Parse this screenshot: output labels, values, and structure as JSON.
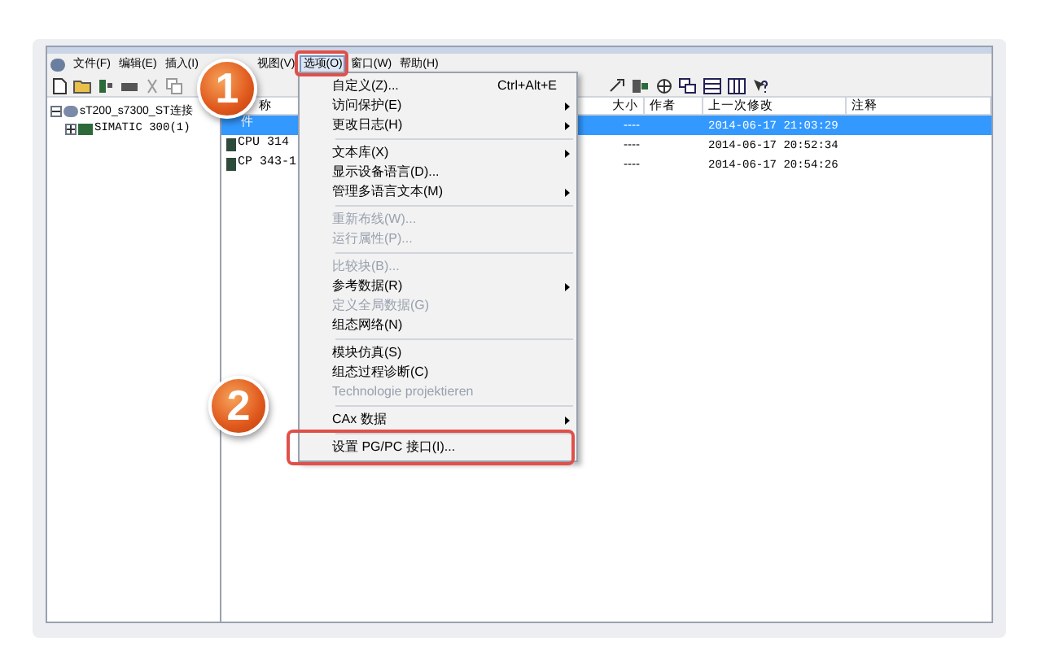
{
  "menu_bar": [
    {
      "label": "文件(F)",
      "selected": false
    },
    {
      "label": "编辑(E)",
      "selected": false
    },
    {
      "label": "插入(I)",
      "selected": false
    },
    {
      "label": "视图(V)",
      "selected": false
    },
    {
      "label": "选项(O)",
      "selected": true
    },
    {
      "label": "窗口(W)",
      "selected": false
    },
    {
      "label": "帮助(H)",
      "selected": false
    }
  ],
  "tree": [
    {
      "label": "sT200_s7300_ST连接",
      "expanded": true,
      "children": [
        {
          "label": "SIMATIC 300(1)",
          "expanded": false
        }
      ]
    }
  ],
  "list": {
    "columns": [
      "称",
      "大小",
      "作者",
      "上一次修改",
      "注释"
    ],
    "rows": [
      {
        "name": "件",
        "size": "----",
        "modified": "2014-06-17 21:03:29",
        "selected": true
      },
      {
        "name": "CPU 314",
        "size": "----",
        "modified": "2014-06-17 20:52:34",
        "selected": false
      },
      {
        "name": "CP 343-1",
        "size": "----",
        "modified": "2014-06-17 20:54:26",
        "selected": false
      }
    ]
  },
  "options_menu": {
    "items": [
      {
        "kind": "item",
        "label": "自定义(Z)...",
        "shortcut": "Ctrl+Alt+E",
        "submenu": false,
        "disabled": false
      },
      {
        "kind": "item",
        "label": "访问保护(E)",
        "submenu": true,
        "disabled": false
      },
      {
        "kind": "item",
        "label": "更改日志(H)",
        "submenu": true,
        "disabled": false
      },
      {
        "kind": "separator"
      },
      {
        "kind": "item",
        "label": "文本库(X)",
        "submenu": true,
        "disabled": false
      },
      {
        "kind": "item",
        "label": "显示设备语言(D)...",
        "submenu": false,
        "disabled": false
      },
      {
        "kind": "item",
        "label": "管理多语言文本(M)",
        "submenu": true,
        "disabled": false
      },
      {
        "kind": "separator"
      },
      {
        "kind": "item",
        "label": "重新布线(W)...",
        "submenu": false,
        "disabled": true
      },
      {
        "kind": "item",
        "label": "运行属性(P)...",
        "submenu": false,
        "disabled": true
      },
      {
        "kind": "separator"
      },
      {
        "kind": "item",
        "label": "比较块(B)...",
        "submenu": false,
        "disabled": true
      },
      {
        "kind": "item",
        "label": "参考数据(R)",
        "submenu": true,
        "disabled": false
      },
      {
        "kind": "item",
        "label": "定义全局数据(G)",
        "submenu": false,
        "disabled": true
      },
      {
        "kind": "item",
        "label": "组态网络(N)",
        "submenu": false,
        "disabled": false
      },
      {
        "kind": "separator"
      },
      {
        "kind": "item",
        "label": "模块仿真(S)",
        "submenu": false,
        "disabled": false
      },
      {
        "kind": "item",
        "label": "组态过程诊断(C)",
        "submenu": false,
        "disabled": false
      },
      {
        "kind": "item",
        "label": "Technologie projektieren",
        "submenu": false,
        "disabled": true
      },
      {
        "kind": "separator"
      },
      {
        "kind": "item",
        "label": "CAx 数据",
        "submenu": true,
        "disabled": false
      },
      {
        "kind": "separator"
      },
      {
        "kind": "item",
        "label": "设置 PG/PC 接口(I)...",
        "submenu": false,
        "disabled": false,
        "highlighted": true
      }
    ]
  },
  "callouts": [
    {
      "label": "1"
    },
    {
      "label": "2"
    }
  ]
}
